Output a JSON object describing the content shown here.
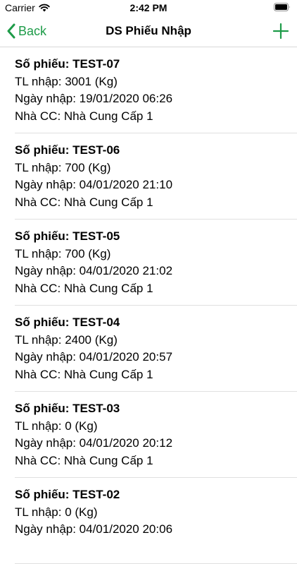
{
  "status_bar": {
    "carrier": "Carrier",
    "time": "2:42 PM",
    "icons": [
      "wifi-icon",
      "battery-icon"
    ]
  },
  "nav": {
    "back_label": "Back",
    "title": "DS Phiếu Nhập",
    "add_icon": "plus-icon",
    "accent_color": "#1d9b48"
  },
  "items": [
    {
      "title": "Số phiếu: TEST-07",
      "weight": "TL nhập: 3001 (Kg)",
      "date": "Ngày nhập: 19/01/2020 06:26",
      "supplier": "Nhà CC: Nhà Cung Cấp 1"
    },
    {
      "title": "Số phiếu: TEST-06",
      "weight": "TL nhập: 700 (Kg)",
      "date": "Ngày nhập: 04/01/2020 21:10",
      "supplier": "Nhà CC: Nhà Cung Cấp 1"
    },
    {
      "title": "Số phiếu: TEST-05",
      "weight": "TL nhập: 700 (Kg)",
      "date": "Ngày nhập: 04/01/2020 21:02",
      "supplier": "Nhà CC: Nhà Cung Cấp 1"
    },
    {
      "title": "Số phiếu: TEST-04",
      "weight": "TL nhập: 2400 (Kg)",
      "date": "Ngày nhập: 04/01/2020 20:57",
      "supplier": "Nhà CC: Nhà Cung Cấp 1"
    },
    {
      "title": "Số phiếu: TEST-03",
      "weight": "TL nhập: 0 (Kg)",
      "date": "Ngày nhập: 04/01/2020 20:12",
      "supplier": "Nhà CC: Nhà Cung Cấp 1"
    },
    {
      "title": "Số phiếu: TEST-02",
      "weight": "TL nhập: 0 (Kg)",
      "date": "Ngày nhập: 04/01/2020 20:06"
    }
  ]
}
